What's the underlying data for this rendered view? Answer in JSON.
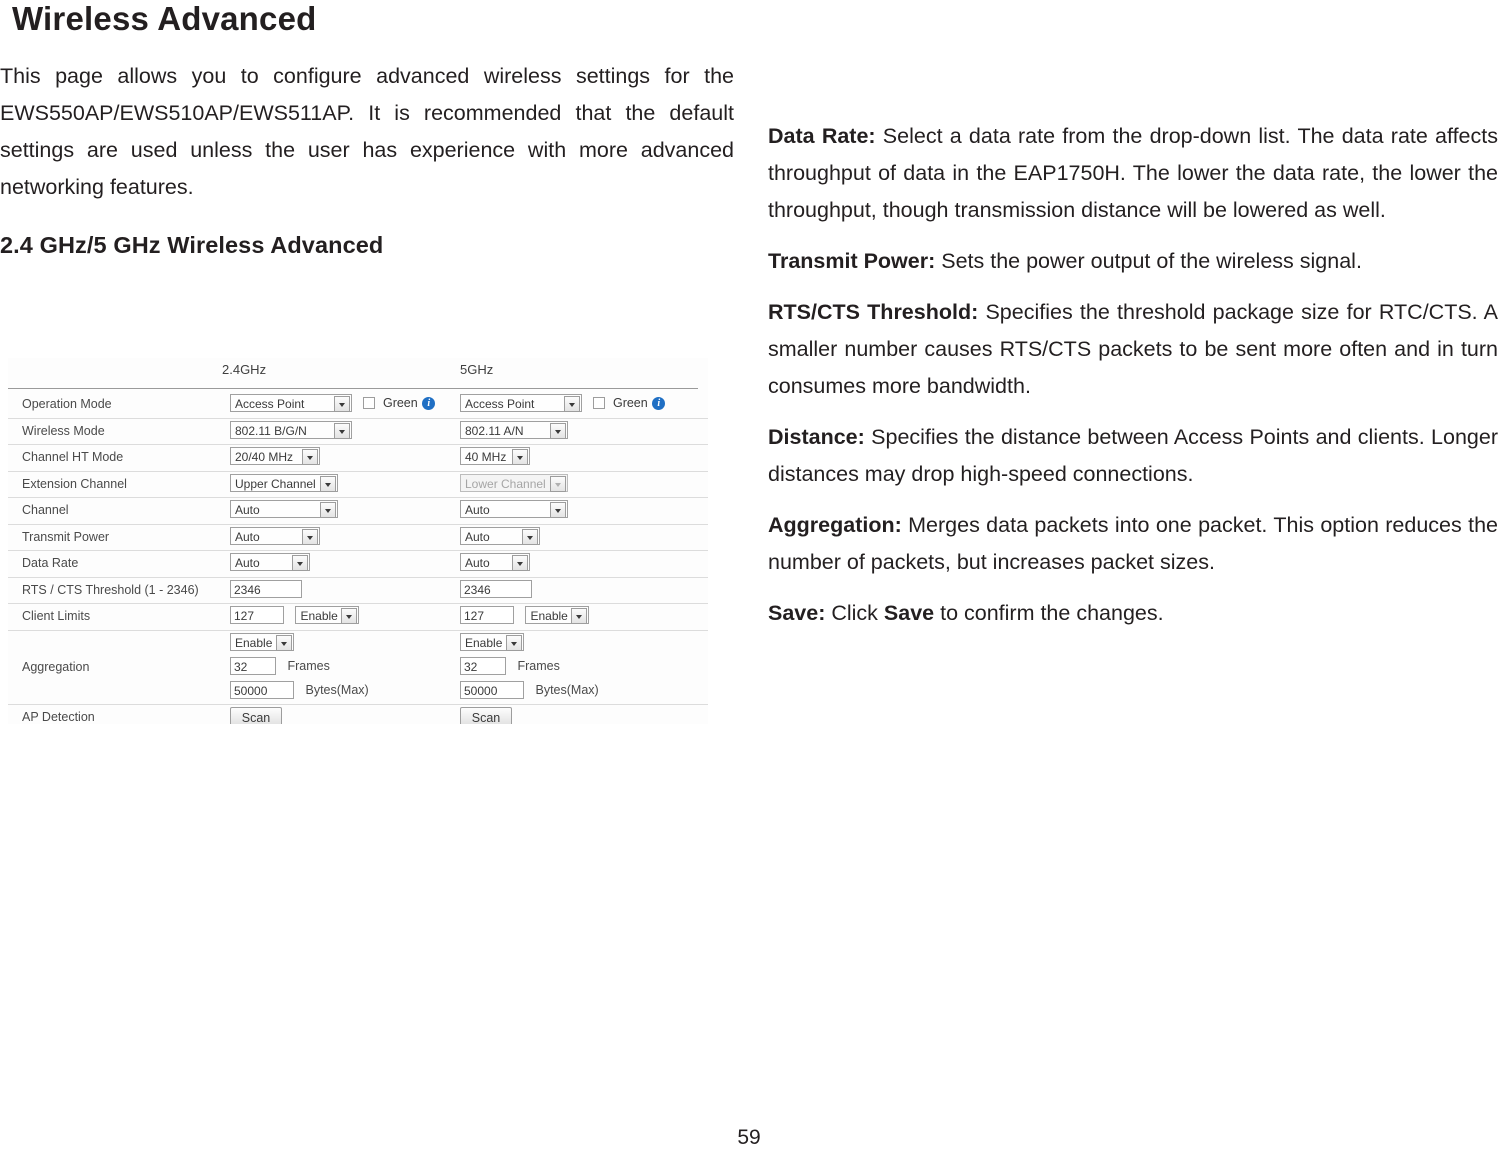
{
  "document": {
    "title": "Wireless Advanced",
    "page_number": "59",
    "intro": "This page allows you to configure advanced wireless settings for the EWS550AP/EWS510AP/EWS511AP. It is recommended that the default settings are used unless the user has experience with more advanced networking features.",
    "subheading": "2.4 GHz/5 GHz Wireless Advanced"
  },
  "definitions": [
    {
      "term": "Data Rate:",
      "text": " Select a data rate from the drop-down list. The data rate affects throughput of data in the EAP1750H. The lower the data rate, the lower the throughput, though transmission distance will be lowered as well."
    },
    {
      "term": "Transmit Power:",
      "text": " Sets the power output of the wireless signal."
    },
    {
      "term": "RTS/CTS Threshold:",
      "text": " Specifies the threshold package size for RTC/CTS. A smaller number causes RTS/CTS packets to be sent more often and in turn consumes more bandwidth."
    },
    {
      "term": "Distance:",
      "text": " Specifies the distance between Access Points and clients. Longer distances may drop high-speed connections."
    },
    {
      "term": "Aggregation:",
      "text": " Merges data packets into one packet. This option reduces the number of packets, but increases packet sizes."
    }
  ],
  "save_note": {
    "term": "Save:",
    "pre": " Click ",
    "bold": "Save",
    "post": " to confirm the changes."
  },
  "figure": {
    "columns": {
      "band_24": "2.4GHz",
      "band_5": "5GHz"
    },
    "rows": {
      "operation_mode": {
        "label": "Operation Mode",
        "v24": "Access Point",
        "v5": "Access Point",
        "green_label": "Green"
      },
      "wireless_mode": {
        "label": "Wireless Mode",
        "v24": "802.11 B/G/N",
        "v5": "802.11 A/N"
      },
      "channel_ht_mode": {
        "label": "Channel HT Mode",
        "v24": "20/40 MHz",
        "v5": "40 MHz"
      },
      "extension_channel": {
        "label": "Extension Channel",
        "v24": "Upper Channel",
        "v5": "Lower Channel"
      },
      "channel": {
        "label": "Channel",
        "v24": "Auto",
        "v5": "Auto"
      },
      "transmit_power": {
        "label": "Transmit Power",
        "v24": "Auto",
        "v5": "Auto"
      },
      "data_rate": {
        "label": "Data Rate",
        "v24": "Auto",
        "v5": "Auto"
      },
      "rts_cts": {
        "label": "RTS / CTS Threshold (1 - 2346)",
        "v24": "2346",
        "v5": "2346"
      },
      "client_limits": {
        "label": "Client Limits",
        "v24_value": "127",
        "v24_state": "Enable",
        "v5_value": "127",
        "v5_state": "Enable"
      },
      "aggregation": {
        "label": "Aggregation",
        "v24_state": "Enable",
        "v5_state": "Enable",
        "v24_frames": "32",
        "v5_frames": "32",
        "frames_unit": "Frames",
        "v24_bytes": "50000",
        "v5_bytes": "50000",
        "bytes_unit": "Bytes(Max)"
      },
      "ap_detection": {
        "label": "AP Detection",
        "v24_button": "Scan",
        "v5_button": "Scan"
      }
    }
  }
}
